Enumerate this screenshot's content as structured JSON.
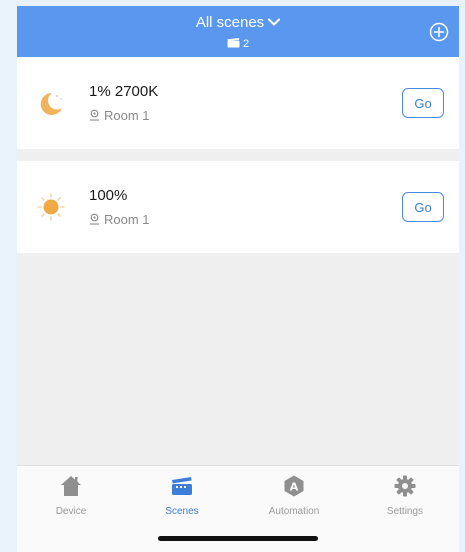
{
  "header": {
    "title": "All scenes",
    "scene_count": "2"
  },
  "scenes": [
    {
      "name": "1% 2700K",
      "room": "Room 1",
      "icon": "moon-icon",
      "go_label": "Go"
    },
    {
      "name": "100%",
      "room": "Room 1",
      "icon": "sun-icon",
      "go_label": "Go"
    }
  ],
  "tabs": [
    {
      "label": "Device",
      "icon": "home-icon",
      "active": false
    },
    {
      "label": "Scenes",
      "icon": "scenes-icon",
      "active": true
    },
    {
      "label": "Automation",
      "icon": "automation-icon",
      "active": false
    },
    {
      "label": "Settings",
      "icon": "gear-icon",
      "active": false
    }
  ],
  "colors": {
    "header_bg": "#5a97ef",
    "accent": "#3d7ed8",
    "inactive": "#9a9a9a"
  }
}
